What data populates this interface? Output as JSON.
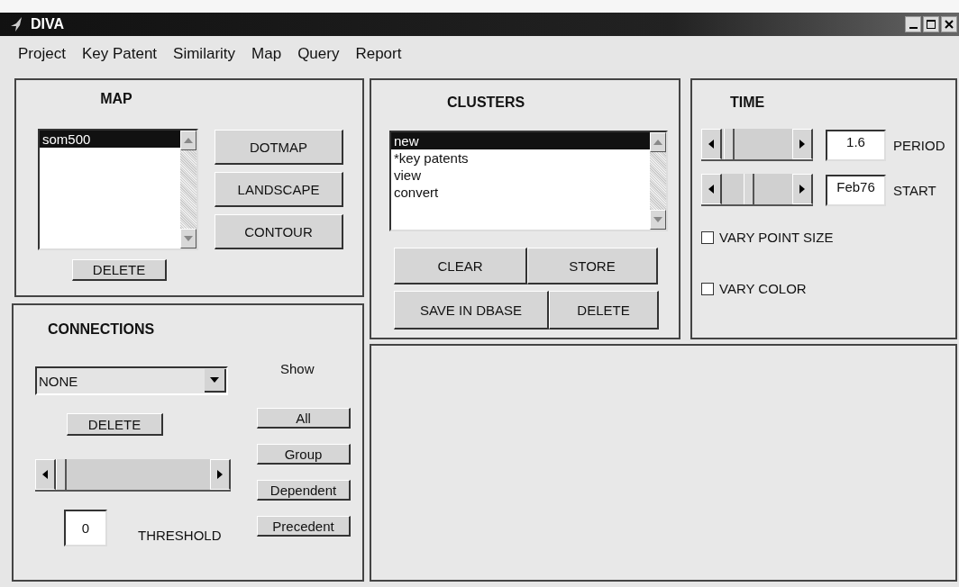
{
  "window": {
    "title": "DIVA"
  },
  "menu": [
    "Project",
    "Key Patent",
    "Similarity",
    "Map",
    "Query",
    "Report"
  ],
  "map_panel": {
    "title": "MAP",
    "list": [
      {
        "label": "som500",
        "selected": true
      }
    ],
    "buttons": [
      "DOTMAP",
      "LANDSCAPE",
      "CONTOUR"
    ],
    "delete_button": "DELETE"
  },
  "clusters_panel": {
    "title": "CLUSTERS",
    "list": [
      {
        "label": "new",
        "selected": true
      },
      {
        "label": "*key patents",
        "selected": false
      },
      {
        "label": "view",
        "selected": false
      },
      {
        "label": "convert",
        "selected": false
      }
    ],
    "buttons": [
      "CLEAR",
      "STORE",
      "SAVE IN DBASE",
      "DELETE"
    ]
  },
  "time_panel": {
    "title": "TIME",
    "sliders": [
      {
        "level": 0.03,
        "value": "1.6",
        "label": "PERIOD"
      },
      {
        "level": 0.37,
        "value": "Feb76",
        "label": "START"
      }
    ],
    "checkboxes": [
      {
        "label": "VARY POINT SIZE",
        "checked": false
      },
      {
        "label": "VARY COLOR",
        "checked": false
      }
    ]
  },
  "connections_panel": {
    "title": "CONNECTIONS",
    "show_label": "Show",
    "dropdown": {
      "value": "NONE"
    },
    "delete_button": "DELETE",
    "slider": {
      "level": 0
    },
    "threshold": {
      "value": "0",
      "label": "THRESHOLD"
    },
    "show_buttons": [
      "All",
      "Group",
      "Dependent",
      "Precedent"
    ]
  }
}
